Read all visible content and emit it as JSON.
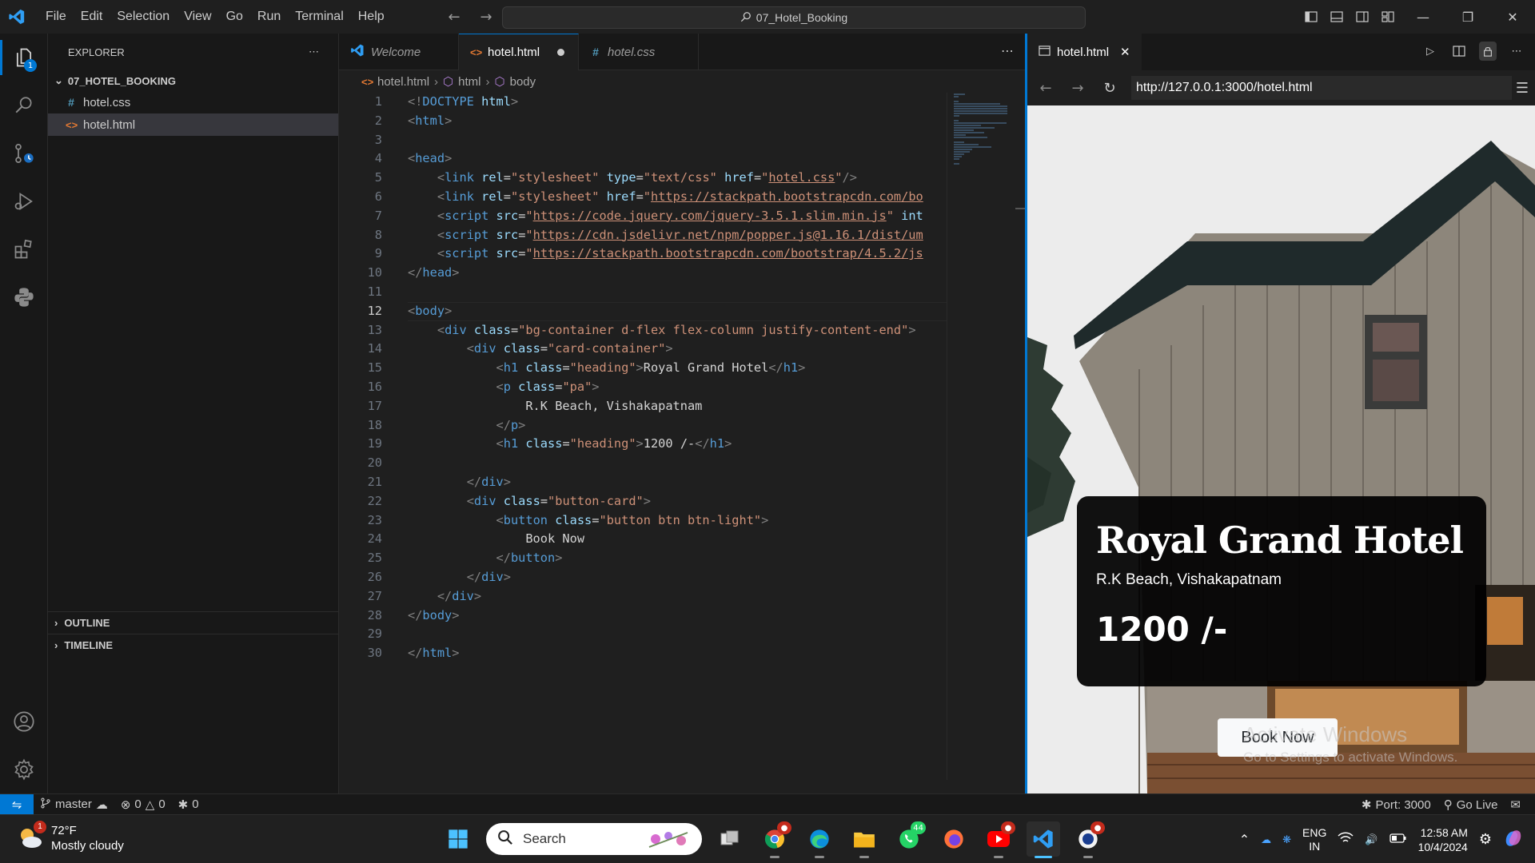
{
  "menu": [
    "File",
    "Edit",
    "Selection",
    "View",
    "Go",
    "Run",
    "Terminal",
    "Help"
  ],
  "command_center": "07_Hotel_Booking",
  "explorer": {
    "title": "EXPLORER",
    "folder": "07_HOTEL_BOOKING",
    "files": [
      {
        "name": "hotel.css",
        "type": "css"
      },
      {
        "name": "hotel.html",
        "type": "html"
      }
    ],
    "outline": "OUTLINE",
    "timeline": "TIMELINE"
  },
  "activity_badge": "1",
  "tabs": [
    {
      "label": "Welcome"
    },
    {
      "label": "hotel.html"
    },
    {
      "label": "hotel.css"
    }
  ],
  "breadcrumb": [
    "hotel.html",
    "html",
    "body"
  ],
  "code_lines": [
    {
      "n": "1",
      "parts": [
        [
          "t",
          "<!"
        ],
        [
          "tag",
          "DOCTYPE"
        ],
        [
          "tx",
          " "
        ],
        [
          "at",
          "html"
        ],
        [
          "t",
          ">"
        ]
      ]
    },
    {
      "n": "2",
      "parts": [
        [
          "t",
          "<"
        ],
        [
          "tag",
          "html"
        ],
        [
          "t",
          ">"
        ]
      ]
    },
    {
      "n": "3",
      "parts": []
    },
    {
      "n": "4",
      "parts": [
        [
          "t",
          "<"
        ],
        [
          "tag",
          "head"
        ],
        [
          "t",
          ">"
        ]
      ]
    },
    {
      "n": "5",
      "parts": [
        [
          "tx",
          "    "
        ],
        [
          "t",
          "<"
        ],
        [
          "tag",
          "link"
        ],
        [
          "tx",
          " "
        ],
        [
          "at",
          "rel"
        ],
        [
          "tx",
          "="
        ],
        [
          "st",
          "\"stylesheet\""
        ],
        [
          "tx",
          " "
        ],
        [
          "at",
          "type"
        ],
        [
          "tx",
          "="
        ],
        [
          "st",
          "\"text/css\""
        ],
        [
          "tx",
          " "
        ],
        [
          "at",
          "href"
        ],
        [
          "tx",
          "="
        ],
        [
          "st",
          "\""
        ],
        [
          "st ul",
          "hotel.css"
        ],
        [
          "st",
          "\""
        ],
        [
          "t",
          "/>"
        ]
      ]
    },
    {
      "n": "6",
      "parts": [
        [
          "tx",
          "    "
        ],
        [
          "t",
          "<"
        ],
        [
          "tag",
          "link"
        ],
        [
          "tx",
          " "
        ],
        [
          "at",
          "rel"
        ],
        [
          "tx",
          "="
        ],
        [
          "st",
          "\"stylesheet\""
        ],
        [
          "tx",
          " "
        ],
        [
          "at",
          "href"
        ],
        [
          "tx",
          "="
        ],
        [
          "st",
          "\""
        ],
        [
          "st ul",
          "https://stackpath.bootstrapcdn.com/bo"
        ]
      ]
    },
    {
      "n": "7",
      "parts": [
        [
          "tx",
          "    "
        ],
        [
          "t",
          "<"
        ],
        [
          "tag",
          "script"
        ],
        [
          "tx",
          " "
        ],
        [
          "at",
          "src"
        ],
        [
          "tx",
          "="
        ],
        [
          "st",
          "\""
        ],
        [
          "st ul",
          "https://code.jquery.com/jquery-3.5.1.slim.min.js"
        ],
        [
          "st",
          "\""
        ],
        [
          "tx",
          " "
        ],
        [
          "at",
          "int"
        ]
      ]
    },
    {
      "n": "8",
      "parts": [
        [
          "tx",
          "    "
        ],
        [
          "t",
          "<"
        ],
        [
          "tag",
          "script"
        ],
        [
          "tx",
          " "
        ],
        [
          "at",
          "src"
        ],
        [
          "tx",
          "="
        ],
        [
          "st",
          "\""
        ],
        [
          "st ul",
          "https://cdn.jsdelivr.net/npm/popper.js@1.16.1/dist/um"
        ]
      ]
    },
    {
      "n": "9",
      "parts": [
        [
          "tx",
          "    "
        ],
        [
          "t",
          "<"
        ],
        [
          "tag",
          "script"
        ],
        [
          "tx",
          " "
        ],
        [
          "at",
          "src"
        ],
        [
          "tx",
          "="
        ],
        [
          "st",
          "\""
        ],
        [
          "st ul",
          "https://stackpath.bootstrapcdn.com/bootstrap/4.5.2/js"
        ]
      ]
    },
    {
      "n": "10",
      "parts": [
        [
          "t",
          "</"
        ],
        [
          "tag",
          "head"
        ],
        [
          "t",
          ">"
        ]
      ]
    },
    {
      "n": "11",
      "parts": []
    },
    {
      "n": "12",
      "parts": [
        [
          "t",
          "<"
        ],
        [
          "tag",
          "body"
        ],
        [
          "t",
          ">"
        ]
      ]
    },
    {
      "n": "13",
      "parts": [
        [
          "tx",
          "    "
        ],
        [
          "t",
          "<"
        ],
        [
          "tag",
          "div"
        ],
        [
          "tx",
          " "
        ],
        [
          "at",
          "class"
        ],
        [
          "tx",
          "="
        ],
        [
          "st",
          "\"bg-container d-flex flex-column justify-content-end\""
        ],
        [
          "t",
          ">"
        ]
      ]
    },
    {
      "n": "14",
      "parts": [
        [
          "tx",
          "        "
        ],
        [
          "t",
          "<"
        ],
        [
          "tag",
          "div"
        ],
        [
          "tx",
          " "
        ],
        [
          "at",
          "class"
        ],
        [
          "tx",
          "="
        ],
        [
          "st",
          "\"card-container\""
        ],
        [
          "t",
          ">"
        ]
      ]
    },
    {
      "n": "15",
      "parts": [
        [
          "tx",
          "            "
        ],
        [
          "t",
          "<"
        ],
        [
          "tag",
          "h1"
        ],
        [
          "tx",
          " "
        ],
        [
          "at",
          "class"
        ],
        [
          "tx",
          "="
        ],
        [
          "st",
          "\"heading\""
        ],
        [
          "t",
          ">"
        ],
        [
          "tx",
          "Royal Grand Hotel"
        ],
        [
          "t",
          "</"
        ],
        [
          "tag",
          "h1"
        ],
        [
          "t",
          ">"
        ]
      ]
    },
    {
      "n": "16",
      "parts": [
        [
          "tx",
          "            "
        ],
        [
          "t",
          "<"
        ],
        [
          "tag",
          "p"
        ],
        [
          "tx",
          " "
        ],
        [
          "at",
          "class"
        ],
        [
          "tx",
          "="
        ],
        [
          "st",
          "\"pa\""
        ],
        [
          "t",
          ">"
        ]
      ]
    },
    {
      "n": "17",
      "parts": [
        [
          "tx",
          "                R.K Beach, Vishakapatnam"
        ]
      ]
    },
    {
      "n": "18",
      "parts": [
        [
          "tx",
          "            "
        ],
        [
          "t",
          "</"
        ],
        [
          "tag",
          "p"
        ],
        [
          "t",
          ">"
        ]
      ]
    },
    {
      "n": "19",
      "parts": [
        [
          "tx",
          "            "
        ],
        [
          "t",
          "<"
        ],
        [
          "tag",
          "h1"
        ],
        [
          "tx",
          " "
        ],
        [
          "at",
          "class"
        ],
        [
          "tx",
          "="
        ],
        [
          "st",
          "\"heading\""
        ],
        [
          "t",
          ">"
        ],
        [
          "tx",
          "1200 /-"
        ],
        [
          "t",
          "</"
        ],
        [
          "tag",
          "h1"
        ],
        [
          "t",
          ">"
        ]
      ]
    },
    {
      "n": "20",
      "parts": []
    },
    {
      "n": "21",
      "parts": [
        [
          "tx",
          "        "
        ],
        [
          "t",
          "</"
        ],
        [
          "tag",
          "div"
        ],
        [
          "t",
          ">"
        ]
      ]
    },
    {
      "n": "22",
      "parts": [
        [
          "tx",
          "        "
        ],
        [
          "t",
          "<"
        ],
        [
          "tag",
          "div"
        ],
        [
          "tx",
          " "
        ],
        [
          "at",
          "class"
        ],
        [
          "tx",
          "="
        ],
        [
          "st",
          "\"button-card\""
        ],
        [
          "t",
          ">"
        ]
      ]
    },
    {
      "n": "23",
      "parts": [
        [
          "tx",
          "            "
        ],
        [
          "t",
          "<"
        ],
        [
          "tag",
          "button"
        ],
        [
          "tx",
          " "
        ],
        [
          "at",
          "class"
        ],
        [
          "tx",
          "="
        ],
        [
          "st",
          "\"button btn btn-light\""
        ],
        [
          "t",
          ">"
        ]
      ]
    },
    {
      "n": "24",
      "parts": [
        [
          "tx",
          "                Book Now"
        ]
      ]
    },
    {
      "n": "25",
      "parts": [
        [
          "tx",
          "            "
        ],
        [
          "t",
          "</"
        ],
        [
          "tag",
          "button"
        ],
        [
          "t",
          ">"
        ]
      ]
    },
    {
      "n": "26",
      "parts": [
        [
          "tx",
          "        "
        ],
        [
          "t",
          "</"
        ],
        [
          "tag",
          "div"
        ],
        [
          "t",
          ">"
        ]
      ]
    },
    {
      "n": "27",
      "parts": [
        [
          "tx",
          "    "
        ],
        [
          "t",
          "</"
        ],
        [
          "tag",
          "div"
        ],
        [
          "t",
          ">"
        ]
      ]
    },
    {
      "n": "28",
      "parts": [
        [
          "t",
          "</"
        ],
        [
          "tag",
          "body"
        ],
        [
          "t",
          ">"
        ]
      ]
    },
    {
      "n": "29",
      "parts": []
    },
    {
      "n": "30",
      "parts": [
        [
          "t",
          "</"
        ],
        [
          "tag",
          "html"
        ],
        [
          "t",
          ">"
        ]
      ]
    }
  ],
  "current_line": "12",
  "preview": {
    "tab_label": "hotel.html",
    "url": "http://127.0.0.1:3000/hotel.html",
    "heading": "Royal Grand Hotel",
    "location": "R.K Beach, Vishakapatnam",
    "price": "1200 /-",
    "button": "Book Now",
    "watermark_title": "Activate Windows",
    "watermark_sub": "Go to Settings to activate Windows."
  },
  "statusbar": {
    "branch": "master",
    "errors": "0",
    "warnings": "0",
    "ports": "0",
    "port": "Port: 3000",
    "go_live": "Go Live"
  },
  "taskbar": {
    "temperature": "72°F",
    "weather": "Mostly cloudy",
    "weather_badge": "1",
    "search": "Search",
    "whatsapp_badge": "44",
    "lang_top": "ENG",
    "lang_bottom": "IN",
    "time": "12:58 AM",
    "date": "10/4/2024"
  },
  "colors": {
    "accent": "#0078d4",
    "editor_bg": "#1f1f1f",
    "sidebar_bg": "#181818",
    "preview_card": "#000000"
  }
}
